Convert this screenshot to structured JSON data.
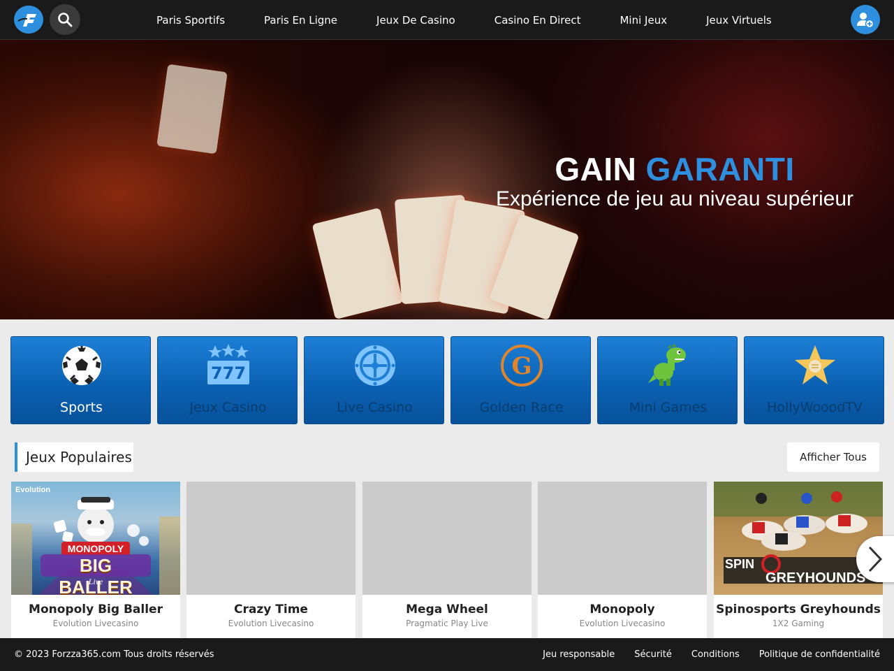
{
  "header": {
    "logo_icon": "forzza-logo-icon",
    "search_icon": "search-icon",
    "user_icon": "add-user-icon",
    "nav": [
      {
        "label": "Paris Sportifs"
      },
      {
        "label": "Paris En Ligne"
      },
      {
        "label": "Jeux De Casino"
      },
      {
        "label": "Casino En Direct"
      },
      {
        "label": "Mini Jeux"
      },
      {
        "label": "Jeux Virtuels"
      }
    ]
  },
  "hero": {
    "title_main": "GAIN",
    "title_accent": "GARANTI",
    "subtitle": "Expérience de jeu au niveau supérieur"
  },
  "categories": [
    {
      "label": "Sports",
      "icon": "soccer-ball-icon",
      "active": true
    },
    {
      "label": "Jeux Casino",
      "icon": "slot-777-icon",
      "active": false
    },
    {
      "label": "Live Casino",
      "icon": "roulette-icon",
      "active": false
    },
    {
      "label": "Golden Race",
      "icon": "golden-race-logo-icon",
      "active": false
    },
    {
      "label": "Mini Games",
      "icon": "dinosaur-icon",
      "active": false
    },
    {
      "label": "HollyWooodTV",
      "icon": "star-icon",
      "active": false
    }
  ],
  "popular": {
    "title": "Jeux Populaires",
    "show_all": "Afficher Tous",
    "games": [
      {
        "title": "Monopoly Big Baller",
        "provider": "Evolution Livecasino",
        "thumb_brand": "Evolution",
        "thumb_line1": "MONOPOLY",
        "thumb_line2": "BIG BALLER",
        "thumb_line3": "Live"
      },
      {
        "title": "Crazy Time",
        "provider": "Evolution Livecasino"
      },
      {
        "title": "Mega Wheel",
        "provider": "Pragmatic Play Live"
      },
      {
        "title": "Monopoly",
        "provider": "Evolution Livecasino"
      },
      {
        "title": "Spinosports Greyhounds",
        "provider": "1X2 Gaming",
        "thumb_line1": "SPIN",
        "thumb_line2": "GREYHOUNDS"
      }
    ]
  },
  "footer": {
    "copyright": "© 2023 Forzza365.com Tous droits réservés",
    "links": [
      {
        "label": "Jeu responsable"
      },
      {
        "label": "Sécurité"
      },
      {
        "label": "Conditions"
      },
      {
        "label": "Politique de confidentialité"
      }
    ]
  },
  "colors": {
    "accent": "#2d8fdd",
    "topbar": "#1a1a1a",
    "tile_blue": "#0b62b4",
    "page_bg": "#ebebeb"
  }
}
